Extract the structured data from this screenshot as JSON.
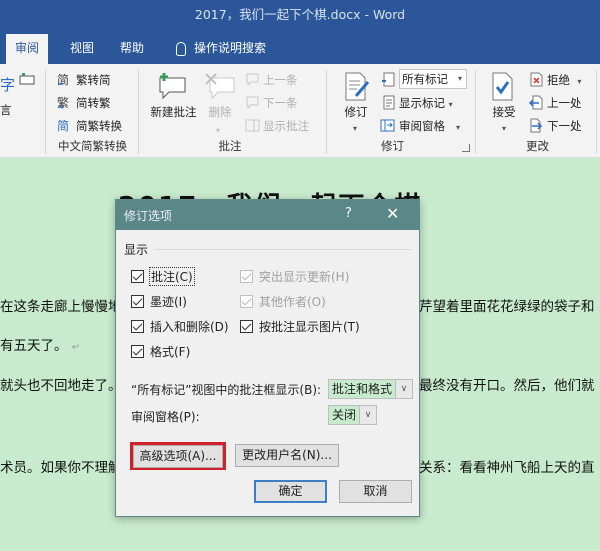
{
  "window": {
    "title": "2017，我们一起下个棋.docx  -  Word"
  },
  "tabs": [
    {
      "label": "审阅",
      "active": true
    },
    {
      "label": "视图"
    },
    {
      "label": "帮助"
    },
    {
      "label": "操作说明搜索",
      "icon": "lightbulb-icon"
    }
  ],
  "ribbon": {
    "partial_left": {
      "top": "字",
      "bottom": "言"
    },
    "chinese_conversion": {
      "label": "中文简繁转换",
      "items": [
        "繁转简",
        "简转繁",
        "简繁转换"
      ]
    },
    "comments": {
      "label": "批注",
      "new_comment": "新建批注",
      "delete": "删除",
      "previous": "上一条",
      "next": "下一条",
      "show_comments": "显示批注"
    },
    "tracking": {
      "label": "修订",
      "track_changes": "修订",
      "markup_select": "所有标记",
      "show_markup": "显示标记",
      "reviewing_pane": "审阅窗格"
    },
    "changes": {
      "label": "更改",
      "accept": "接受",
      "reject": "拒绝",
      "previous": "上一处",
      "next": "下一处"
    }
  },
  "document": {
    "title": "2017，我们一起下个棋",
    "lines": [
      "在这条走廊上慢慢地",
      "芹望着里面花花绿绿的袋子和",
      "有五天了。",
      "就头也不回地走了。",
      "最终没有开口。然后，他们就",
      "术员。如果你不理解",
      "关系：看看神州飞船上天的直"
    ]
  },
  "dialog": {
    "title": "修订选项",
    "help": "?",
    "close": "✕",
    "section": "显示",
    "checkboxes": [
      {
        "label": "批注(C)",
        "checked": true,
        "enabled": true
      },
      {
        "label": "突出显示更新(H)",
        "checked": true,
        "enabled": false
      },
      {
        "label": "墨迹(I)",
        "checked": true,
        "enabled": true
      },
      {
        "label": "其他作者(O)",
        "checked": true,
        "enabled": false
      },
      {
        "label": "插入和删除(D)",
        "checked": true,
        "enabled": true
      },
      {
        "label": "按批注显示图片(T)",
        "checked": true,
        "enabled": true
      },
      {
        "label": "格式(F)",
        "checked": true,
        "enabled": true
      }
    ],
    "balloon_label": "“所有标记”视图中的批注框显示(B):",
    "balloon_value": "批注和格式",
    "pane_label": "审阅窗格(P):",
    "pane_value": "关闭",
    "advanced_button": "高级选项(A)...",
    "change_user_button": "更改用户名(N)...",
    "ok_button": "确定",
    "cancel_button": "取消",
    "highlight_color": "#d0202a"
  }
}
